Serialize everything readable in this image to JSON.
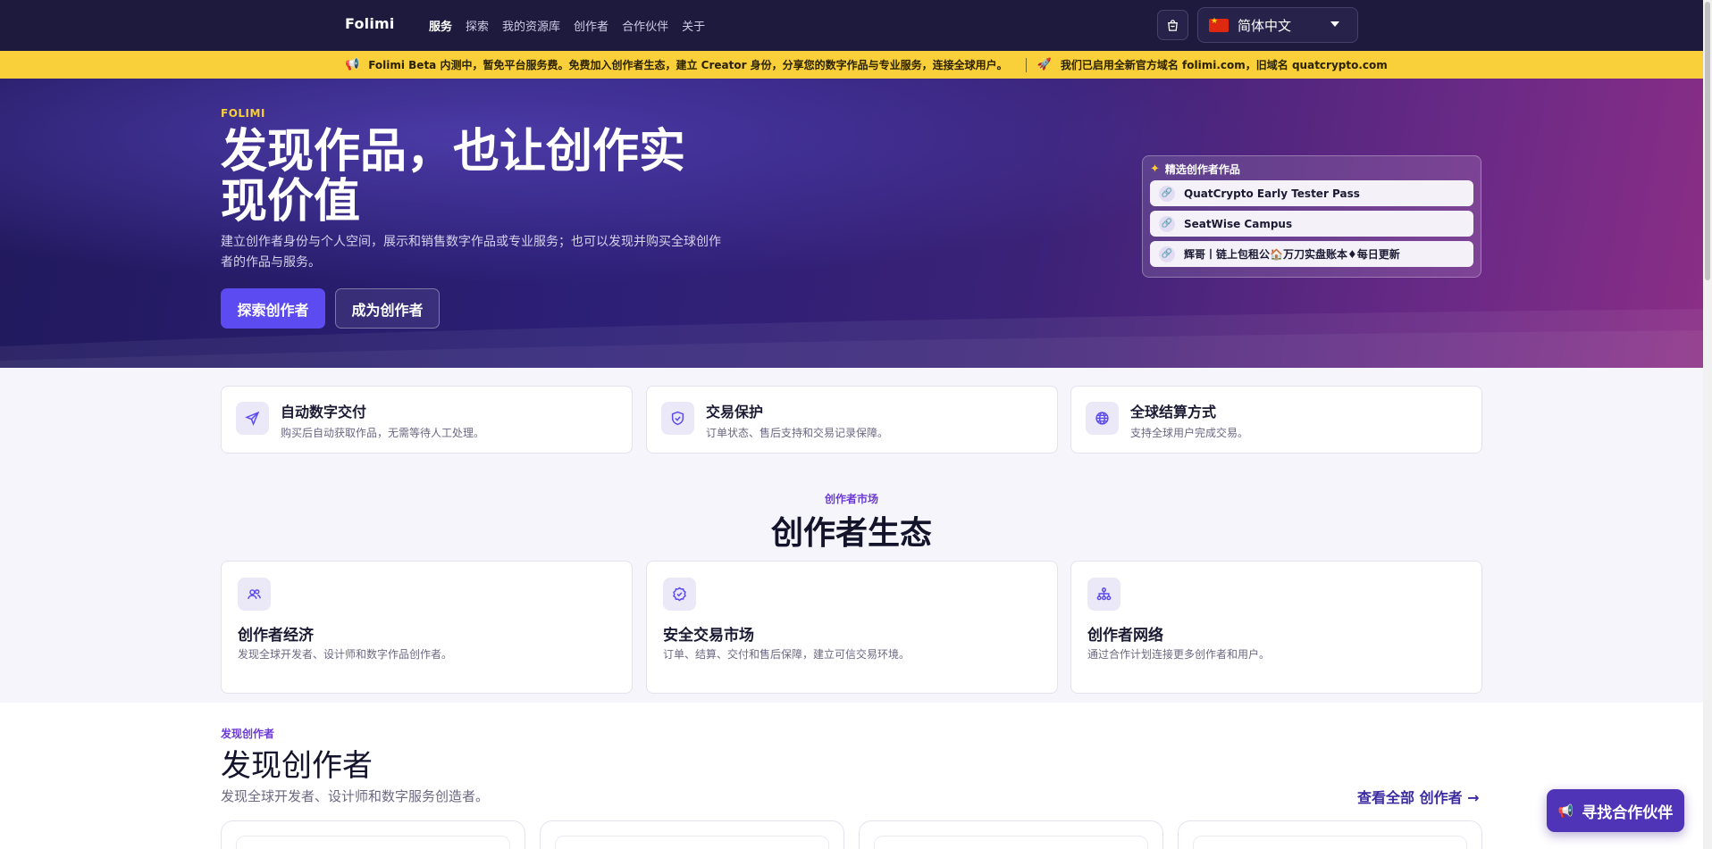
{
  "nav": {
    "brand": "Folimi",
    "links": [
      "服务",
      "探索",
      "我的资源库",
      "创作者",
      "合作伙伴",
      "关于"
    ],
    "active_index": 0,
    "language": "简体中文"
  },
  "banner": {
    "message": "Folimi Beta 内测中，暂免平台服务费。免费加入创作者生态，建立 Creator 身份，分享您的数字作品与专业服务，连接全球用户。",
    "domain_notice": "我们已启用全新官方域名 folimi.com，旧域名 quatcrypto.com"
  },
  "hero": {
    "kicker": "FOLIMI",
    "title": "发现作品，也让创作实现价值",
    "subtitle": "建立创作者身份与个人空间，展示和销售数字作品或专业服务；也可以发现并购买全球创作者的作品与服务。",
    "primary_button": "探索创作者",
    "secondary_button": "成为创作者",
    "featured": {
      "heading": "精选创作者作品",
      "items": [
        "QuatCrypto Early Tester Pass",
        "SeatWise Campus",
        "辉哥丨链上包租公🏠万刀实盘账本♦每日更新"
      ]
    }
  },
  "features": [
    {
      "title": "自动数字交付",
      "desc": "购买后自动获取作品，无需等待人工处理。",
      "icon": "send-icon"
    },
    {
      "title": "交易保护",
      "desc": "订单状态、售后支持和交易记录保障。",
      "icon": "shield-icon"
    },
    {
      "title": "全球结算方式",
      "desc": "支持全球用户完成交易。",
      "icon": "globe-icon"
    }
  ],
  "ecosystem": {
    "kicker": "创作者市场",
    "title": "创作者生态",
    "cards": [
      {
        "title": "创作者经济",
        "desc": "发现全球开发者、设计师和数字作品创作者。",
        "icon": "users-icon"
      },
      {
        "title": "安全交易市场",
        "desc": "订单、结算、交付和售后保障，建立可信交易环境。",
        "icon": "badge-check-icon"
      },
      {
        "title": "创作者网络",
        "desc": "通过合作计划连接更多创作者和用户。",
        "icon": "network-icon"
      }
    ]
  },
  "discover": {
    "kicker": "发现创作者",
    "title": "发现创作者",
    "subtitle": "发现全球开发者、设计师和数字服务创造者。",
    "view_all": "查看全部 创作者 →"
  },
  "partner_button": "寻找合作伙伴",
  "colors": {
    "nav_bg": "#1d1a3d",
    "banner_bg": "#f9cf3a",
    "accent": "#5b4bf0",
    "kicker": "#6c3bd6"
  }
}
